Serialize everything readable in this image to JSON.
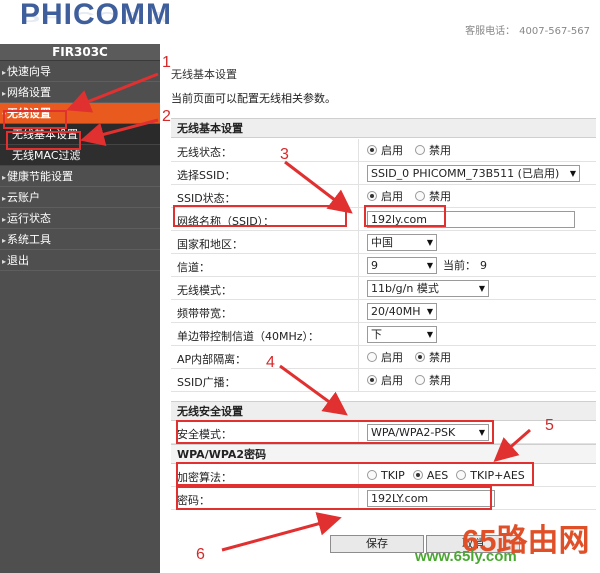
{
  "header": {
    "logo": "PHICOMM",
    "hotline_label": "客服电话：",
    "hotline_number": "4007-567-567"
  },
  "sidebar": {
    "model": "FIR303C",
    "items": [
      {
        "label": "快速向导"
      },
      {
        "label": "网络设置"
      },
      {
        "label": "无线设置"
      },
      {
        "label": "无线基本设置"
      },
      {
        "label": "无线MAC过滤"
      },
      {
        "label": "健康节能设置"
      },
      {
        "label": "云账户"
      },
      {
        "label": "运行状态"
      },
      {
        "label": "系统工具"
      },
      {
        "label": "退出"
      }
    ]
  },
  "main": {
    "heading": "无线基本设置",
    "description": "当前页面可以配置无线相关参数。",
    "basic_section": "无线基本设置",
    "rows": {
      "wireless_status": {
        "label": "无线状态：",
        "opt1": "启用",
        "opt2": "禁用"
      },
      "select_ssid": {
        "label": "选择SSID：",
        "value": "SSID_0 PHICOMM_73B511 (已启用)"
      },
      "ssid_status": {
        "label": "SSID状态：",
        "opt1": "启用",
        "opt2": "禁用"
      },
      "ssid_name": {
        "label": "网络名称（SSID）：",
        "value": "192ly.com"
      },
      "country": {
        "label": "国家和地区：",
        "value": "中国"
      },
      "channel": {
        "label": "信道：",
        "value": "9",
        "current_label": "当前：",
        "current_value": "9"
      },
      "mode": {
        "label": "无线模式：",
        "value": "11b/g/n 模式"
      },
      "bandwidth": {
        "label": "频带带宽：",
        "value": "20/40MH"
      },
      "sideband": {
        "label": "单边带控制信道（40MHz）：",
        "value": "下"
      },
      "ap_isolation": {
        "label": "AP内部隔离：",
        "opt1": "启用",
        "opt2": "禁用"
      },
      "ssid_broadcast": {
        "label": "SSID广播：",
        "opt1": "启用",
        "opt2": "禁用"
      }
    },
    "security_section": "无线安全设置",
    "security_mode": {
      "label": "安全模式：",
      "value": "WPA/WPA2-PSK"
    },
    "wpa_section": "WPA/WPA2密码",
    "encryption": {
      "label": "加密算法：",
      "opt1": "TKIP",
      "opt2": "AES",
      "opt3": "TKIP+AES"
    },
    "password": {
      "label": "密码：",
      "value": "192LY.com"
    },
    "save_button": "保存",
    "reset_button": "取消"
  },
  "annotations": [
    "1",
    "2",
    "3",
    "4",
    "5",
    "6"
  ],
  "watermark": {
    "line1": "65路由网",
    "line2": "www.65ly.com"
  },
  "colors": {
    "accent_orange": "#e85a1e",
    "annotation_red": "#e13030",
    "sidebar_bg": "#4f4f4f",
    "logo_blue": "#3e5f9c"
  }
}
